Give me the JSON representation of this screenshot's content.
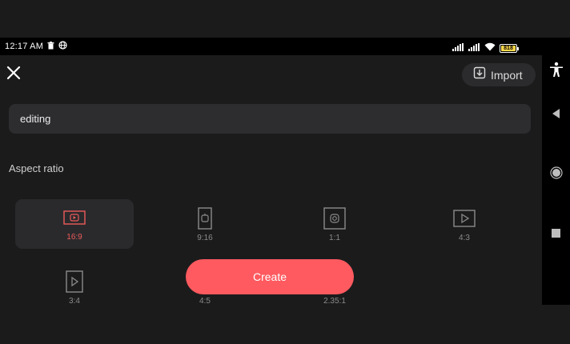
{
  "status_bar": {
    "time": "12:17 AM",
    "battery_label": "818"
  },
  "header": {
    "import_label": "Import"
  },
  "project": {
    "name_value": "editing"
  },
  "aspect_ratio": {
    "title": "Aspect ratio",
    "options": [
      {
        "label": "16:9",
        "icon": "youtube-icon",
        "selected": true
      },
      {
        "label": "9:16",
        "icon": "tiktok-icon",
        "selected": false
      },
      {
        "label": "1:1",
        "icon": "instagram-icon",
        "selected": false
      },
      {
        "label": "4:3",
        "icon": "play-frame-icon",
        "selected": false
      },
      {
        "label": "3:4",
        "icon": "play-frame-icon",
        "selected": false
      },
      {
        "label": "4:5",
        "icon": "",
        "selected": false
      },
      {
        "label": "2.35:1",
        "icon": "",
        "selected": false
      }
    ]
  },
  "actions": {
    "create_label": "Create"
  },
  "colors": {
    "accent": "#ff5a5f",
    "selected_text": "#ee5a5a",
    "background": "#1b1b1c"
  }
}
